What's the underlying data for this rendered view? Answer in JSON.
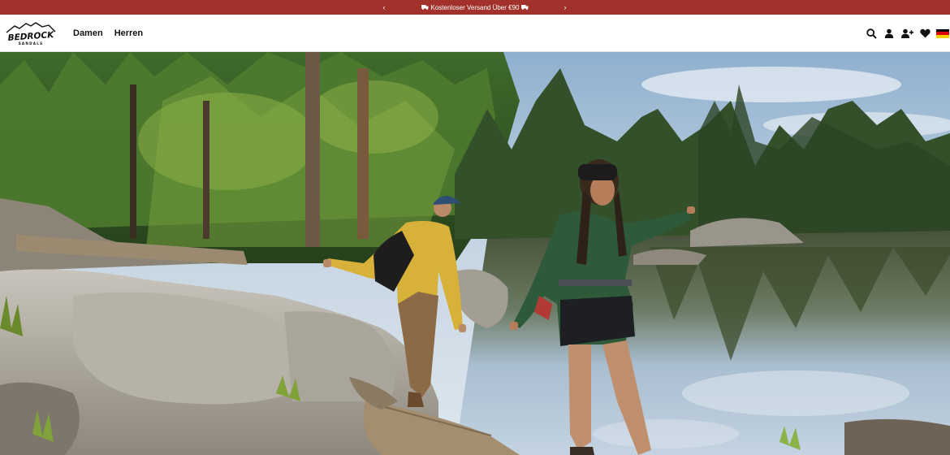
{
  "announcement": {
    "message": "Kostenloser Versand Über €90",
    "prev_icon": "chevron-left-icon",
    "next_icon": "chevron-right-icon",
    "truck_icon": "truck-icon",
    "background": "#a1312a"
  },
  "header": {
    "logo": {
      "brand": "BEDROCK",
      "tagline": "SANDALS"
    },
    "nav": [
      {
        "label": "Damen"
      },
      {
        "label": "Herren"
      }
    ],
    "tools": [
      {
        "icon": "search-icon"
      },
      {
        "icon": "account-icon"
      },
      {
        "icon": "add-user-icon"
      },
      {
        "icon": "heart-icon"
      },
      {
        "icon": "germany-flag-icon"
      }
    ]
  },
  "hero": {
    "scene": "two hikers in yellow and green jackets crossing rocks beside a mountain lake in a pine forest"
  }
}
